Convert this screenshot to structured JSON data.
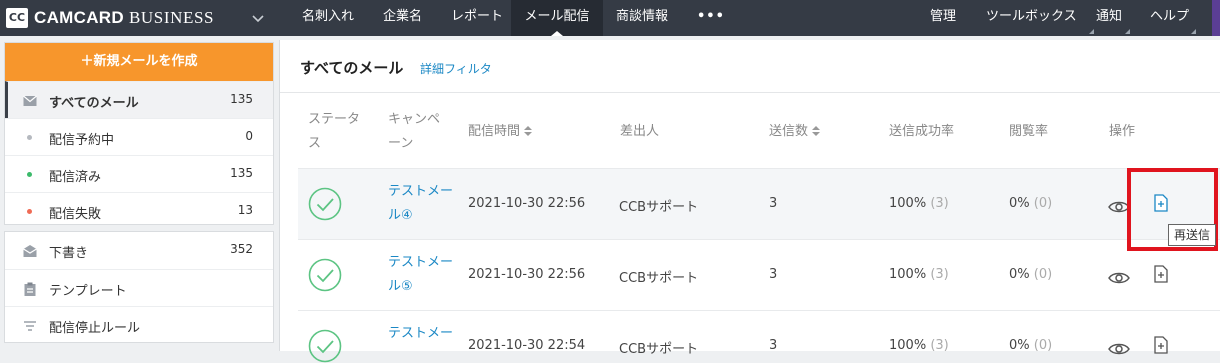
{
  "topbar": {
    "logo": "CC",
    "brand_bold": "CAMCARD",
    "brand_rest": "BUSINESS",
    "nav": [
      "名刺入れ",
      "企業名",
      "レポート",
      "メール配信",
      "商談情報",
      "•••"
    ],
    "active_nav": "メール配信",
    "right": [
      "管理",
      "ツールボックス",
      "通知",
      "ヘルプ"
    ]
  },
  "sidebar": {
    "new_mail": "＋新規メールを作成",
    "mail_items": [
      {
        "label": "すべてのメール",
        "count": "135"
      },
      {
        "label": "配信予約中",
        "count": "0"
      },
      {
        "label": "配信済み",
        "count": "135"
      },
      {
        "label": "配信失敗",
        "count": "13"
      }
    ],
    "other_items": [
      {
        "label": "下書き",
        "count": "352"
      },
      {
        "label": "テンプレート",
        "count": ""
      },
      {
        "label": "配信停止ルール",
        "count": ""
      }
    ]
  },
  "main": {
    "title": "すべてのメール",
    "filter": "詳細フィルタ",
    "headers": {
      "status_1": "ステータ",
      "status_2": "ス",
      "campaign_1": "キャンペ",
      "campaign_2": "ーン",
      "time": "配信時間",
      "sender": "差出人",
      "sent": "送信数",
      "rate": "送信成功率",
      "open": "閲覧率",
      "ops": "操作"
    },
    "rows": [
      {
        "campaign_1": "テストメー",
        "campaign_2": "ル④",
        "time": "2021-10-30 22:56",
        "sender": "CCBサポート",
        "sent": "3",
        "rate": "100%",
        "rate_n": "(3)",
        "open": "0%",
        "open_n": "(0)"
      },
      {
        "campaign_1": "テストメー",
        "campaign_2": "ル⑤",
        "time": "2021-10-30 22:56",
        "sender": "CCBサポート",
        "sent": "3",
        "rate": "100%",
        "rate_n": "(3)",
        "open": "0%",
        "open_n": "(0)"
      },
      {
        "campaign_1": "テストメー",
        "campaign_2": "",
        "time": "2021-10-30 22:54",
        "sender": "CCBサポート",
        "sent": "3",
        "rate": "100%",
        "rate_n": "(3)",
        "open": "0%",
        "open_n": "(0)"
      }
    ],
    "tooltip": "再送信"
  },
  "colors": {
    "topbar": "#353b45",
    "accent_orange": "#f7962c",
    "link_blue": "#1b88c5",
    "check_green": "#5cc483",
    "highlight_red": "#e0141e"
  }
}
